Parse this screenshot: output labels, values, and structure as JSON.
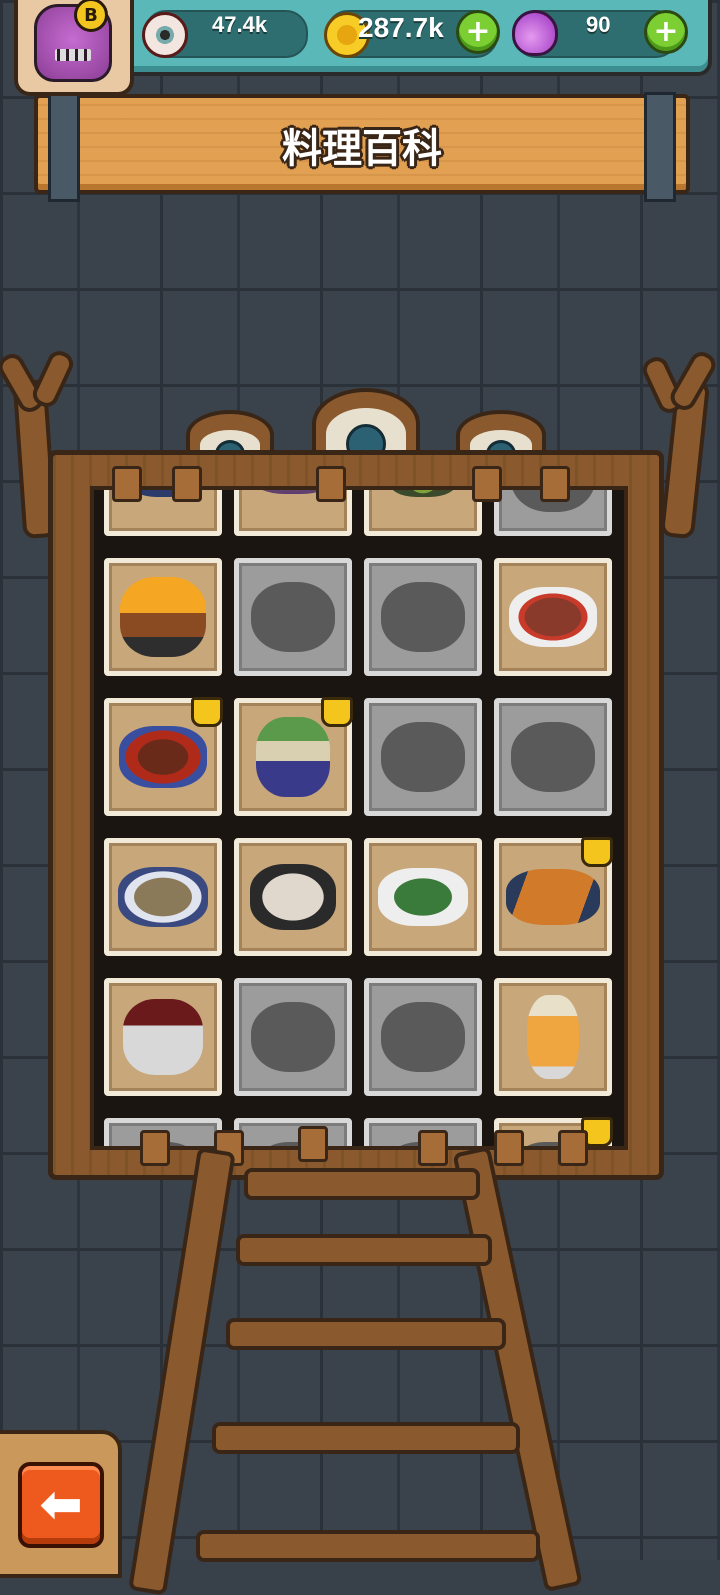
{
  "header": {
    "player_badge": "B",
    "eyeballs": "47.4k",
    "coins": "287.7k",
    "potions": "90",
    "plus_label": "+"
  },
  "banner": {
    "title": "料理百科"
  },
  "grid": {
    "rows": [
      [
        "unlocked",
        "unlocked",
        "unlocked",
        "locked"
      ],
      [
        "unlocked",
        "locked",
        "locked",
        "unlocked"
      ],
      [
        "unlocked",
        "unlocked",
        "locked",
        "locked"
      ],
      [
        "unlocked",
        "unlocked",
        "unlocked",
        "unlocked"
      ],
      [
        "unlocked",
        "locked",
        "locked",
        "unlocked"
      ],
      [
        "locked",
        "locked",
        "locked",
        "unlocked"
      ]
    ],
    "dishes": [
      [
        "bowl-dish-icon",
        "pie-dish-icon",
        "salad-dish-icon",
        "locked-dish-silhouette"
      ],
      [
        "flaming-roast-icon",
        "locked-dish-silhouette",
        "locked-dish-silhouette",
        "spicy-plate-icon"
      ],
      [
        "braised-meat-icon",
        "herb-soup-icon",
        "locked-dish-silhouette",
        "locked-dish-silhouette"
      ],
      [
        "fish-plate-icon",
        "porridge-bowl-icon",
        "green-salad-icon",
        "grilled-skewers-icon"
      ],
      [
        "chili-bowl-icon",
        "locked-dish-silhouette",
        "locked-dish-silhouette",
        "fruit-drink-icon"
      ],
      [
        "locked-dish-silhouette",
        "locked-dish-silhouette",
        "locked-dish-silhouette",
        "locked-dish-silhouette"
      ]
    ],
    "crowned": [
      "2-0",
      "2-1",
      "3-3",
      "5-3"
    ]
  },
  "colors": {
    "wall": "#3a424c",
    "wood": "#8a5a2e",
    "outline": "#3a2617",
    "topbar": "#5bb8b8",
    "plus_button": "#7ccf32",
    "back_button": "#ee5a1e"
  },
  "back_button": {
    "icon": "back-arrow-icon",
    "glyph": "⬅"
  }
}
